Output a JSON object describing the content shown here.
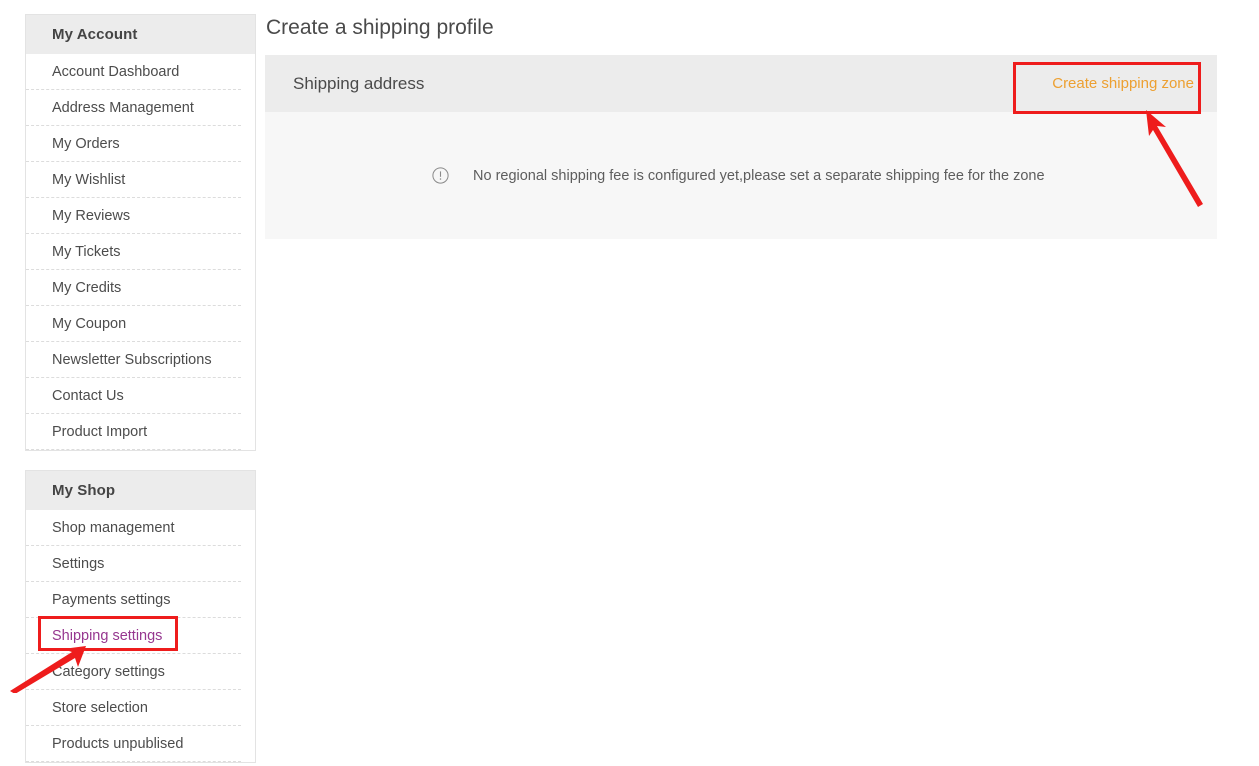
{
  "page": {
    "title": "Create a shipping profile"
  },
  "sidebar": {
    "blocks": [
      {
        "heading": "My Account",
        "items": [
          {
            "label": "Account Dashboard",
            "current": false
          },
          {
            "label": "Address Management",
            "current": false
          },
          {
            "label": "My Orders",
            "current": false
          },
          {
            "label": "My Wishlist",
            "current": false
          },
          {
            "label": "My Reviews",
            "current": false
          },
          {
            "label": "My Tickets",
            "current": false
          },
          {
            "label": "My Credits",
            "current": false
          },
          {
            "label": "My Coupon",
            "current": false
          },
          {
            "label": "Newsletter Subscriptions",
            "current": false
          },
          {
            "label": "Contact Us",
            "current": false
          },
          {
            "label": "Product Import",
            "current": false
          }
        ]
      },
      {
        "heading": "My Shop",
        "items": [
          {
            "label": "Shop management",
            "current": false
          },
          {
            "label": "Settings",
            "current": false
          },
          {
            "label": "Payments settings",
            "current": false
          },
          {
            "label": "Shipping settings",
            "current": true
          },
          {
            "label": "Category settings",
            "current": false
          },
          {
            "label": "Store selection",
            "current": false
          },
          {
            "label": "Products unpublised",
            "current": false
          }
        ]
      }
    ]
  },
  "panel": {
    "title": "Shipping address",
    "action_label": "Create shipping zone",
    "empty_message": "No regional shipping fee is configured yet,please set a separate shipping fee for the zone",
    "info_icon": "exclamation-circle-icon"
  },
  "colors": {
    "accent_orange": "#eda031",
    "current_link_purple": "#96378f",
    "annotation_red": "#ee1c1c",
    "panel_header_gray": "#ececec",
    "panel_body_gray": "#f7f7f7"
  }
}
